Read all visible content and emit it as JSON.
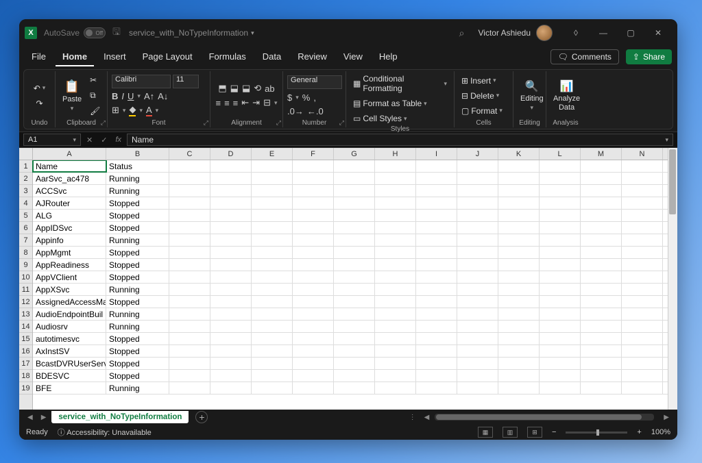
{
  "titlebar": {
    "autosave_label": "AutoSave",
    "toggle_state": "Off",
    "filename": "service_with_NoTypeInformation",
    "user": "Victor Ashiedu"
  },
  "tabs": {
    "items": [
      "File",
      "Home",
      "Insert",
      "Page Layout",
      "Formulas",
      "Data",
      "Review",
      "View",
      "Help"
    ],
    "active": "Home",
    "comments": "Comments",
    "share": "Share"
  },
  "ribbon": {
    "undo": "Undo",
    "clipboard": {
      "paste": "Paste",
      "label": "Clipboard"
    },
    "font": {
      "name": "Calibri",
      "size": "11",
      "label": "Font"
    },
    "alignment": {
      "label": "Alignment"
    },
    "number": {
      "format": "General",
      "label": "Number"
    },
    "styles": {
      "conditional": "Conditional Formatting",
      "table": "Format as Table",
      "cell": "Cell Styles",
      "label": "Styles"
    },
    "cells": {
      "insert": "Insert",
      "delete": "Delete",
      "format": "Format",
      "label": "Cells"
    },
    "editing": {
      "label": "Editing",
      "name": "Editing"
    },
    "analysis": {
      "name": "Analyze Data",
      "label": "Analysis"
    }
  },
  "formulabar": {
    "name": "A1",
    "value": "Name"
  },
  "columns": [
    "A",
    "B",
    "C",
    "D",
    "E",
    "F",
    "G",
    "H",
    "I",
    "J",
    "K",
    "L",
    "M",
    "N"
  ],
  "rows": [
    {
      "n": 1,
      "a": "Name",
      "b": "Status"
    },
    {
      "n": 2,
      "a": "AarSvc_ac478",
      "b": "Running"
    },
    {
      "n": 3,
      "a": "ACCSvc",
      "b": "Running"
    },
    {
      "n": 4,
      "a": "AJRouter",
      "b": "Stopped"
    },
    {
      "n": 5,
      "a": "ALG",
      "b": "Stopped"
    },
    {
      "n": 6,
      "a": "AppIDSvc",
      "b": "Stopped"
    },
    {
      "n": 7,
      "a": "Appinfo",
      "b": "Running"
    },
    {
      "n": 8,
      "a": "AppMgmt",
      "b": "Stopped"
    },
    {
      "n": 9,
      "a": "AppReadiness",
      "b": "Stopped"
    },
    {
      "n": 10,
      "a": "AppVClient",
      "b": "Stopped"
    },
    {
      "n": 11,
      "a": "AppXSvc",
      "b": "Running"
    },
    {
      "n": 12,
      "a": "AssignedAccessMa",
      "b": "Stopped"
    },
    {
      "n": 13,
      "a": "AudioEndpointBuil",
      "b": "Running"
    },
    {
      "n": 14,
      "a": "Audiosrv",
      "b": "Running"
    },
    {
      "n": 15,
      "a": "autotimesvc",
      "b": "Stopped"
    },
    {
      "n": 16,
      "a": "AxInstSV",
      "b": "Stopped"
    },
    {
      "n": 17,
      "a": "BcastDVRUserServ",
      "b": "Stopped"
    },
    {
      "n": 18,
      "a": "BDESVC",
      "b": "Stopped"
    },
    {
      "n": 19,
      "a": "BFE",
      "b": "Running"
    }
  ],
  "sheettabs": {
    "active": "service_with_NoTypeInformation"
  },
  "statusbar": {
    "ready": "Ready",
    "accessibility": "Accessibility: Unavailable",
    "zoom": "100%"
  }
}
